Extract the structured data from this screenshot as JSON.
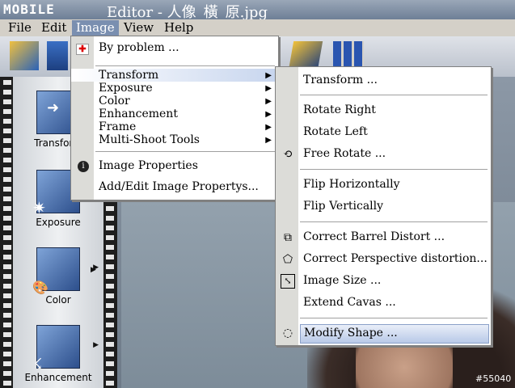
{
  "window": {
    "logo": "MOBILE",
    "title": "Editor - 人像_橫_原.jpg"
  },
  "menubar": [
    "File",
    "Edit",
    "Image",
    "View",
    "Help"
  ],
  "image_menu": {
    "items": [
      {
        "label": "By problem ...",
        "icon": "first-aid-icon"
      },
      {
        "label": "Transform",
        "submenu": true
      },
      {
        "label": "Exposure",
        "submenu": true
      },
      {
        "label": "Color",
        "submenu": true
      },
      {
        "label": "Enhancement",
        "submenu": true
      },
      {
        "label": "Frame",
        "submenu": true
      },
      {
        "label": "Multi-Shoot Tools",
        "submenu": true
      },
      {
        "label": "Image Properties",
        "icon": "info-icon"
      },
      {
        "label": "Add/Edit Image Propertys..."
      }
    ]
  },
  "transform_menu": {
    "items": [
      {
        "label": "Transform ..."
      },
      {
        "label": "Rotate Right"
      },
      {
        "label": "Rotate Left"
      },
      {
        "label": "Free Rotate ...",
        "icon": "rotate-icon"
      },
      {
        "label": "Flip Horizontally"
      },
      {
        "label": "Flip Vertically"
      },
      {
        "label": "Correct Barrel Distort ...",
        "icon": "barrel-icon"
      },
      {
        "label": "Correct Perspective distortion...",
        "icon": "perspective-icon"
      },
      {
        "label": "Image Size ...",
        "icon": "resize-icon"
      },
      {
        "label": "Extend Cavas ..."
      },
      {
        "label": "Modify Shape ...",
        "icon": "shape-icon"
      }
    ]
  },
  "tools": [
    "Transform",
    "Exposure",
    "Color",
    "Enhancement"
  ],
  "watermark": "#55040"
}
